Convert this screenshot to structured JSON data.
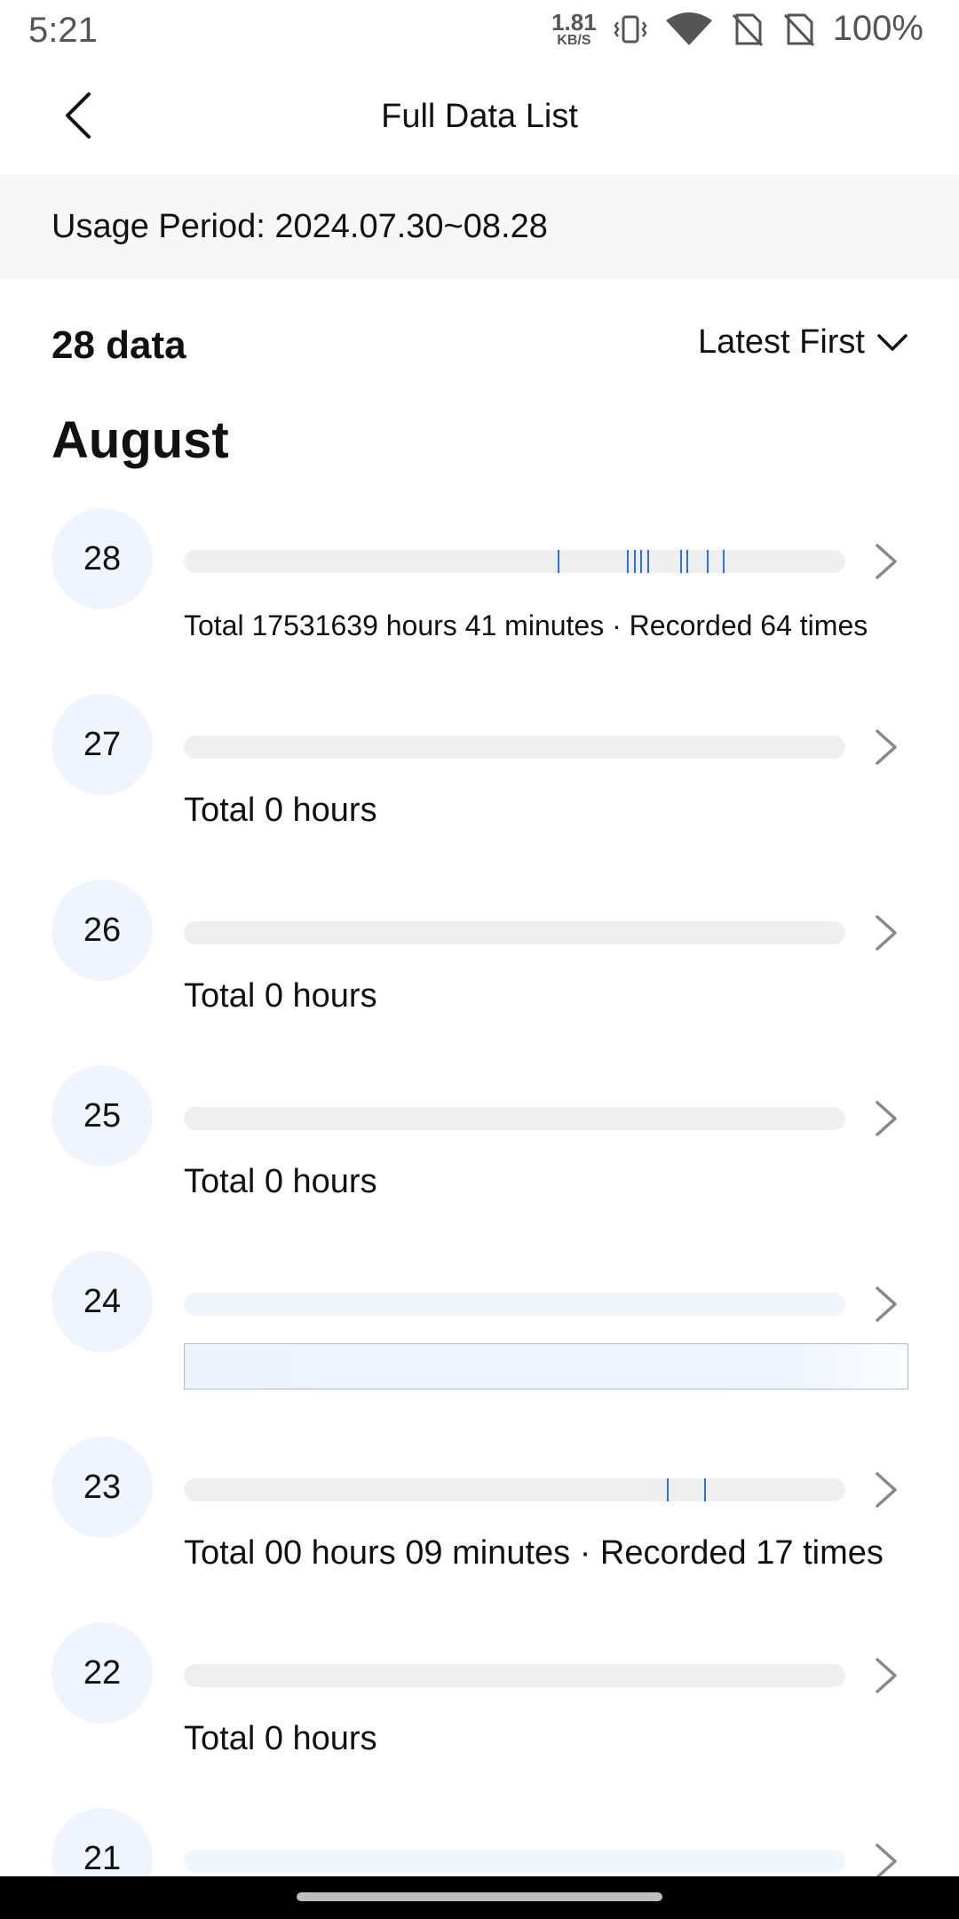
{
  "status": {
    "time": "5:21",
    "net_speed_value": "1.81",
    "net_speed_unit": "KB/S",
    "battery": "100%"
  },
  "header": {
    "title": "Full Data List"
  },
  "period": {
    "text": "Usage Period: 2024.07.30~08.28"
  },
  "summary": {
    "count": "28 data",
    "sort_label": "Latest First"
  },
  "month": "August",
  "days": [
    {
      "day": "28",
      "text": "Total 17531639 hours 41 minutes · Recorded 64 times",
      "ticks": [
        0.565,
        0.67,
        0.68,
        0.69,
        0.7,
        0.75,
        0.76,
        0.79,
        0.815
      ]
    },
    {
      "day": "27",
      "text": "Total 0 hours",
      "ticks": []
    },
    {
      "day": "26",
      "text": "Total 0 hours",
      "ticks": []
    },
    {
      "day": "25",
      "text": "Total 0 hours",
      "ticks": []
    },
    {
      "day": "24",
      "text": "",
      "ticks": []
    },
    {
      "day": "23",
      "text": "Total 00 hours 09 minutes · Recorded 17 times",
      "ticks": [
        0.73,
        0.787
      ]
    },
    {
      "day": "22",
      "text": "Total 0 hours",
      "ticks": []
    },
    {
      "day": "21",
      "text": "",
      "ticks": []
    }
  ],
  "colors": {
    "accent": "#2f72d9",
    "circle_bg": "#eff4fd",
    "track_bg": "#efefef"
  }
}
